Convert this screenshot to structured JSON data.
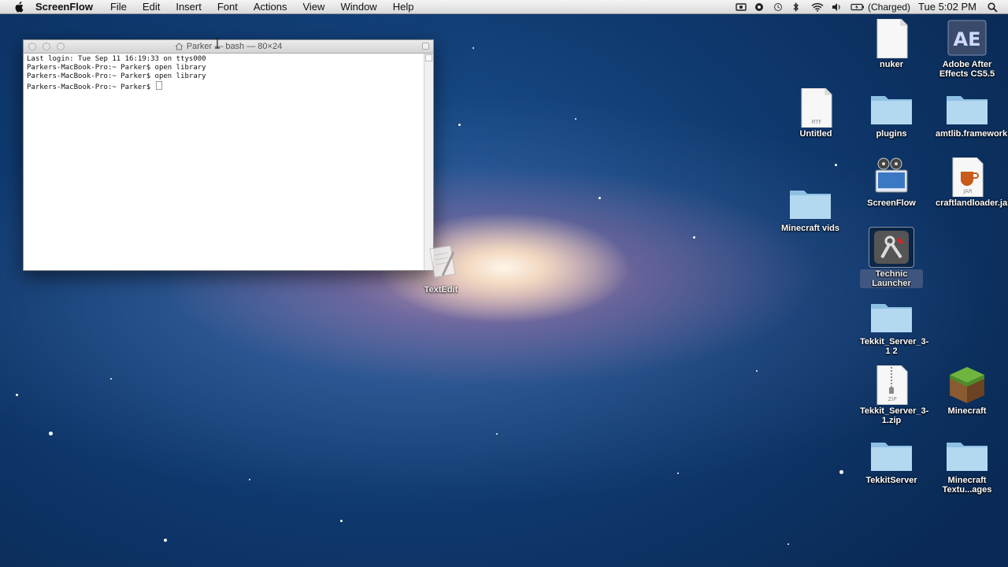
{
  "menubar": {
    "app_name": "ScreenFlow",
    "items": [
      "File",
      "Edit",
      "Insert",
      "Font",
      "Actions",
      "View",
      "Window",
      "Help"
    ],
    "battery_status": "(Charged)",
    "clock": "Tue 5:02 PM"
  },
  "terminal": {
    "title": "Parker — bash — 80×24",
    "lines": [
      "Last login: Tue Sep 11 16:19:33 on ttys000",
      "Parkers-MacBook-Pro:~ Parker$ open library",
      "Parkers-MacBook-Pro:~ Parker$ open library",
      "Parkers-MacBook-Pro:~ Parker$ "
    ]
  },
  "desktop_icons": {
    "nuker": "nuker",
    "after_effects": "Adobe After Effects CS5.5",
    "untitled": "Untitled",
    "untitled_badge": "RTF",
    "plugins": "plugins",
    "amtlib": "amtlib.framework",
    "screenflow": "ScreenFlow",
    "craftland": "craftlandloader.jar",
    "craftland_badge": "JAR",
    "minecraft_vids": "Minecraft vids",
    "technic": "Technic Launcher",
    "textedit": "TextEdit",
    "tekkit_server_folder": "Tekkit_Server_3-1 2",
    "tekkit_zip": "Tekkit_Server_3-1.zip",
    "tekkit_zip_badge": "ZIP",
    "minecraft": "Minecraft",
    "tekkitserver": "TekkitServer",
    "minecraft_textures": "Minecraft Textu...ages",
    "after_effects_badge": "AE"
  }
}
